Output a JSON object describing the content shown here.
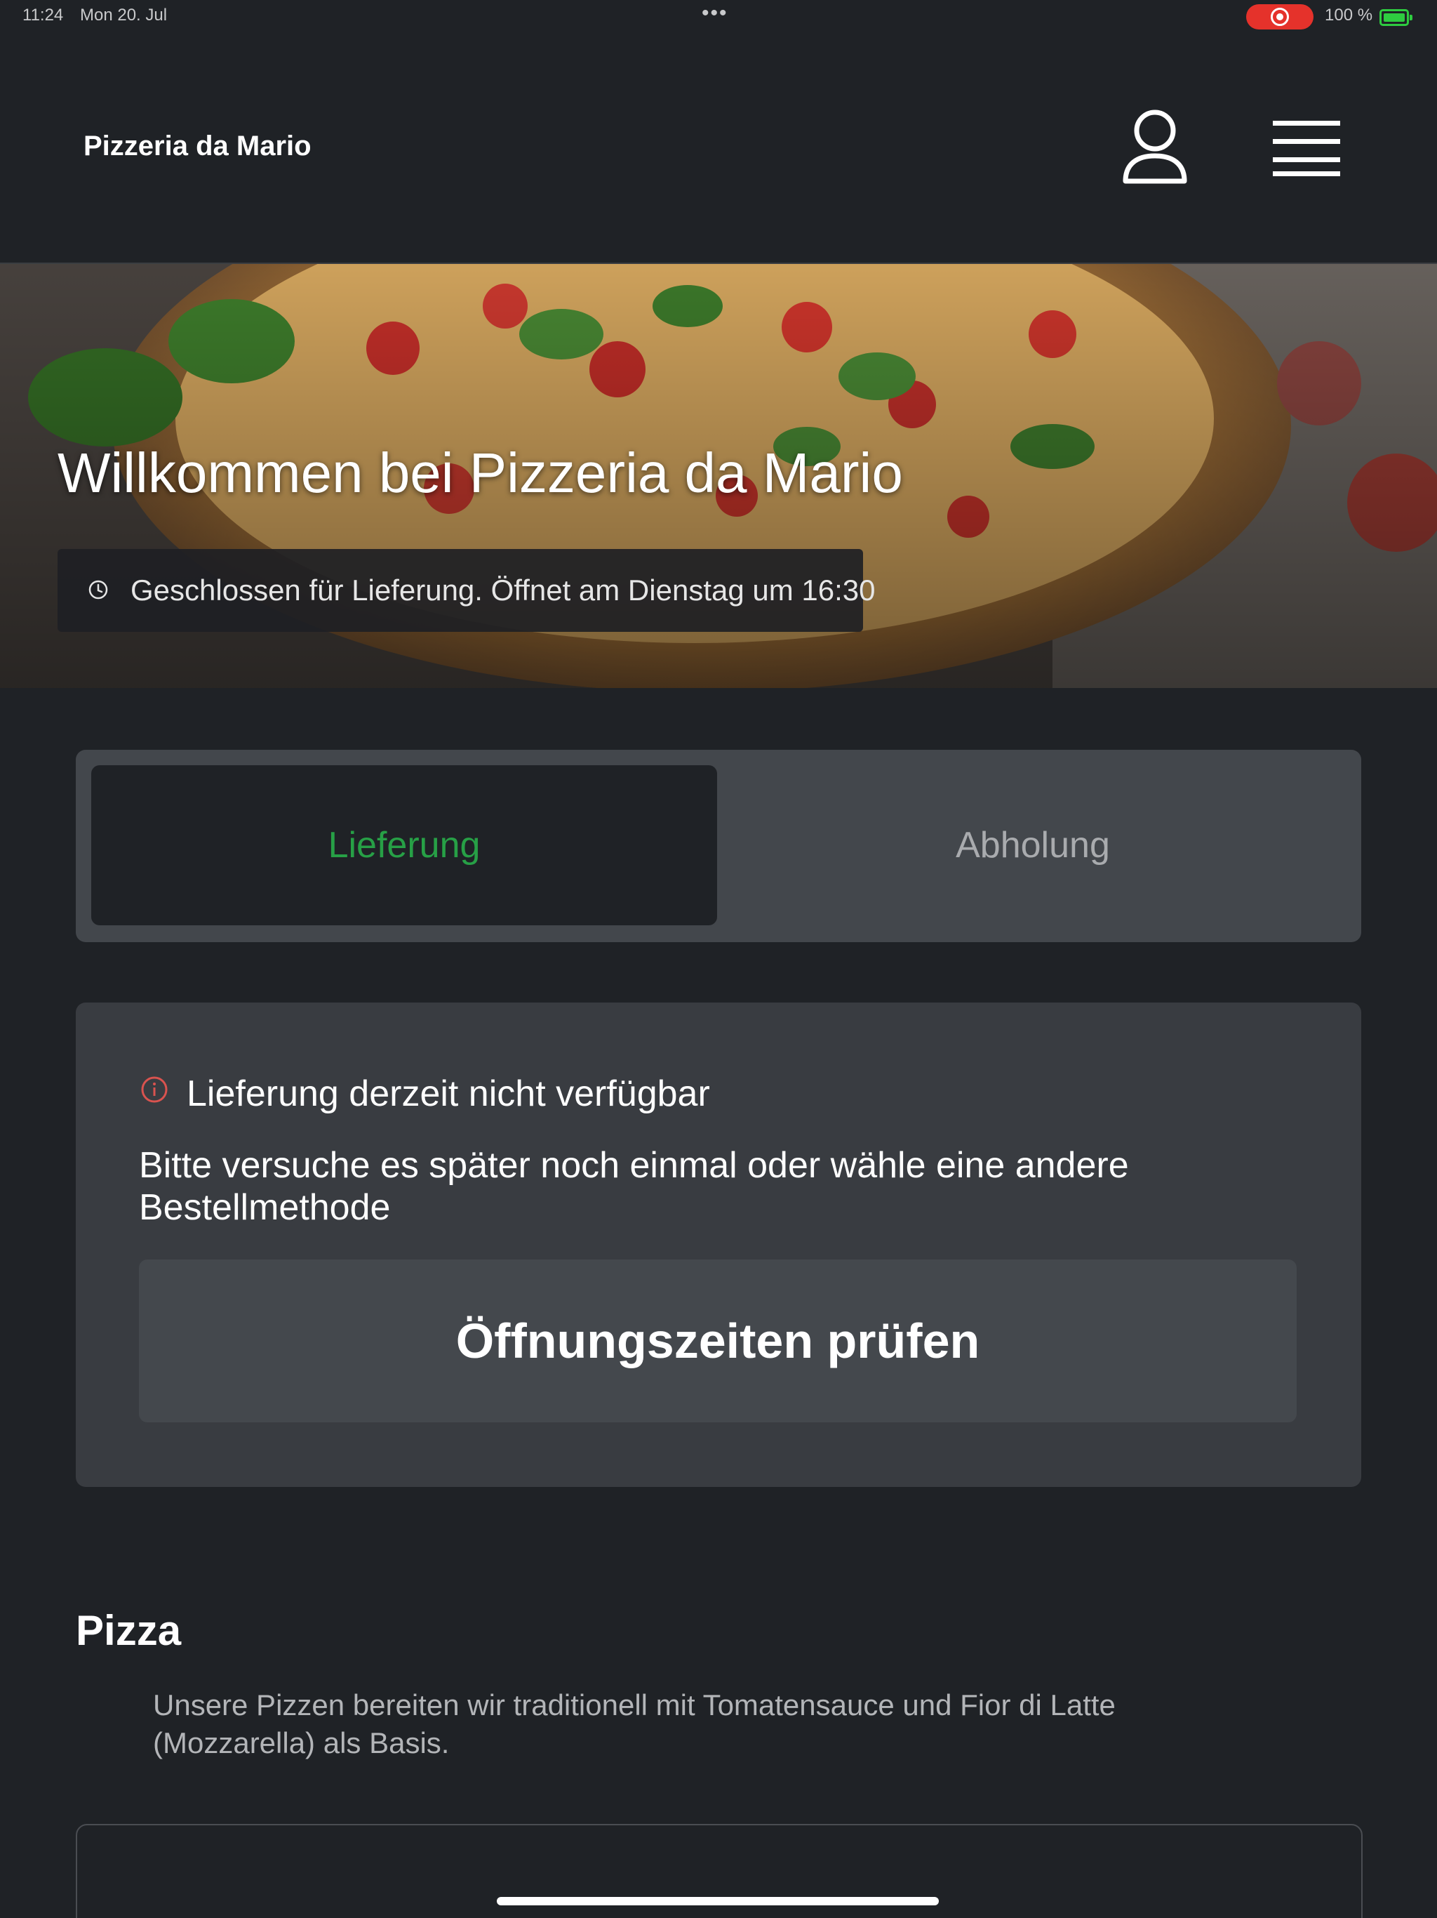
{
  "status_bar": {
    "time": "11:24",
    "date": "Mon 20. Jul",
    "multitask": "•••",
    "battery": "100 %",
    "record_color": "#e5322b",
    "battery_color": "#2ecc40"
  },
  "header": {
    "brand": "Pizzeria da Mario",
    "profile_icon": "user-icon",
    "menu_icon": "hamburger-menu-icon"
  },
  "hero": {
    "title": "Willkommen bei Pizzeria da Mario",
    "status": "Geschlossen für Lieferung. Öffnet am Dienstag um 16:30",
    "status_icon": "clock-icon"
  },
  "tabs": [
    {
      "label": "Lieferung",
      "active": true
    },
    {
      "label": "Abholung",
      "active": false
    }
  ],
  "notice": {
    "icon": "info-icon",
    "title": "Lieferung derzeit nicht verfügbar",
    "text": "Bitte versuche es später noch einmal oder wähle eine andere Bestellmethode",
    "button": "Öffnungszeiten prüfen"
  },
  "section": {
    "title": "Pizza",
    "description": "Unsere Pizzen bereiten wir traditionell mit Tomatensauce und Fior di Latte (Mozzarella) als Basis."
  },
  "colors": {
    "background": "#1f2226",
    "card": "#393c41",
    "accent_green": "#27a046",
    "info_red": "#d9534f"
  }
}
